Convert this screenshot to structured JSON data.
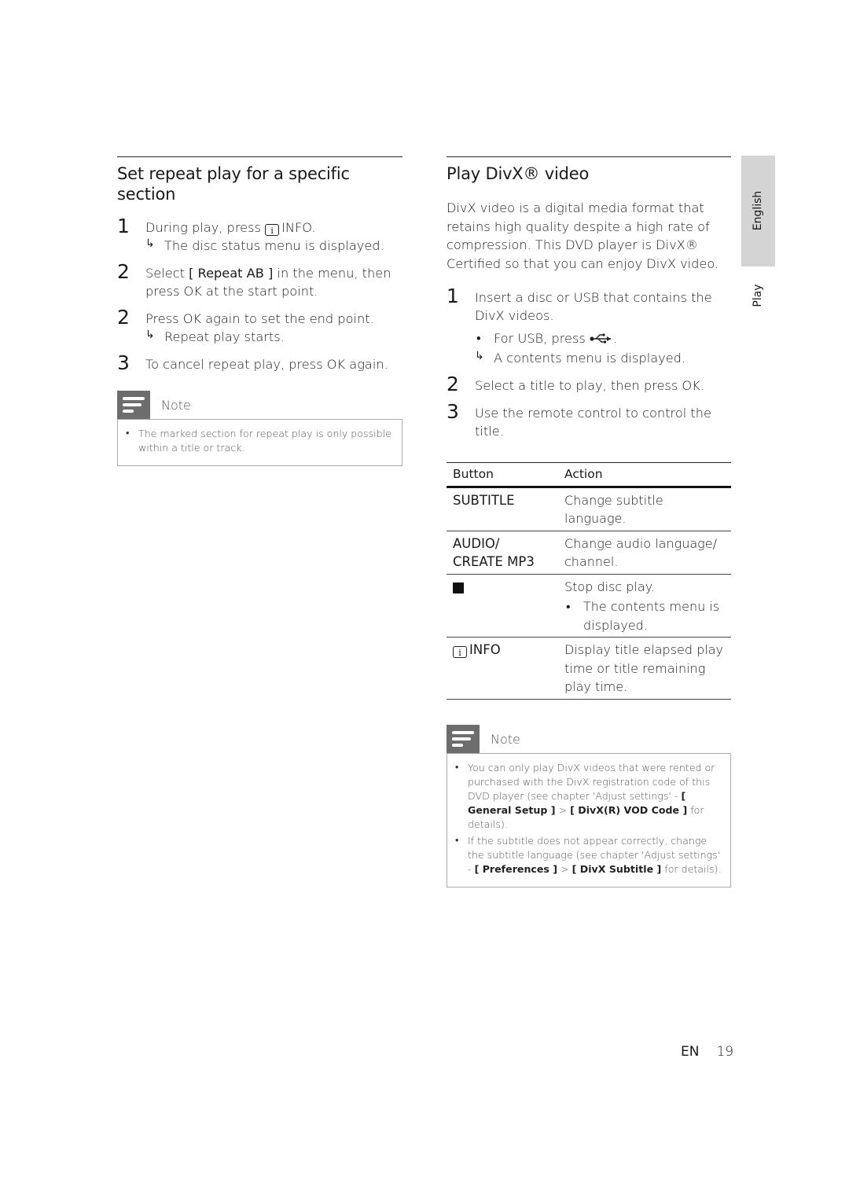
{
  "left_section": {
    "title": "Set repeat play for a specific section",
    "steps": [
      {
        "num": "1",
        "text_before": "During play, press ",
        "icon": "info-icon",
        "icon_label": "i",
        "text_after": "INFO.",
        "result": "The disc status menu is displayed."
      },
      {
        "num": "2",
        "text_before": "Select ",
        "bold": "[ Repeat AB ]",
        "text_after": " in the menu, then press OK at the start point."
      },
      {
        "num": "2",
        "text": "Press OK again to set the end point.",
        "result": "Repeat play starts."
      },
      {
        "num": "3",
        "text": "To cancel repeat play, press OK again."
      }
    ],
    "note": {
      "title": "Note",
      "items": [
        "The marked section for repeat play is only possible within a title or track."
      ]
    }
  },
  "right_section": {
    "title": "Play DivX® video",
    "intro": "DivX video is a digital media format that retains high quality despite a high rate of compression. This DVD player is DivX® Certified so that you can enjoy DivX video.",
    "steps": [
      {
        "num": "1",
        "text": "Insert a disc or USB that contains the DivX videos.",
        "bullet_before": "For USB, press ",
        "bullet_icon": "usb-icon",
        "bullet_after": ".",
        "result": "A contents menu is displayed."
      },
      {
        "num": "2",
        "text": "Select a title to play, then press OK."
      },
      {
        "num": "3",
        "text": "Use the remote control to control the title."
      }
    ],
    "table": {
      "headers": [
        "Button",
        "Action"
      ],
      "rows": [
        {
          "button": "SUBTITLE",
          "action": "Change subtitle language."
        },
        {
          "button": "AUDIO/ CREATE MP3",
          "action": "Change audio language/ channel."
        },
        {
          "button_icon": "stop-icon",
          "action": "Stop disc play.",
          "sub_bullet": "The contents menu is displayed."
        },
        {
          "button_icon": "info-icon",
          "button_icon_label": "i",
          "button": "INFO",
          "action": "Display title elapsed play time or title remaining play time."
        }
      ]
    },
    "note": {
      "title": "Note",
      "items": [
        {
          "text_a": "You can only play DivX videos that were rented or purchased with the DivX registration code of this DVD player (see chapter 'Adjust settings' - ",
          "bold_a": "[ General Setup ]",
          "sep": " > ",
          "bold_b": "[ DivX(R) VOD Code ]",
          "text_b": " for details)."
        },
        {
          "text_a": "If the subtitle does not appear correctly, change the subtitle language (see chapter 'Adjust settings' - ",
          "bold_a": "[ Preferences ]",
          "sep": " > ",
          "bold_b": "[ DivX Subtitle ]",
          "text_b": " for details)."
        }
      ]
    }
  },
  "side_tabs": {
    "language": "English",
    "chapter": "Play"
  },
  "footer": {
    "lang": "EN",
    "page": "19"
  },
  "glyphs": {
    "bullet": "•",
    "result_arrow": "↳"
  }
}
